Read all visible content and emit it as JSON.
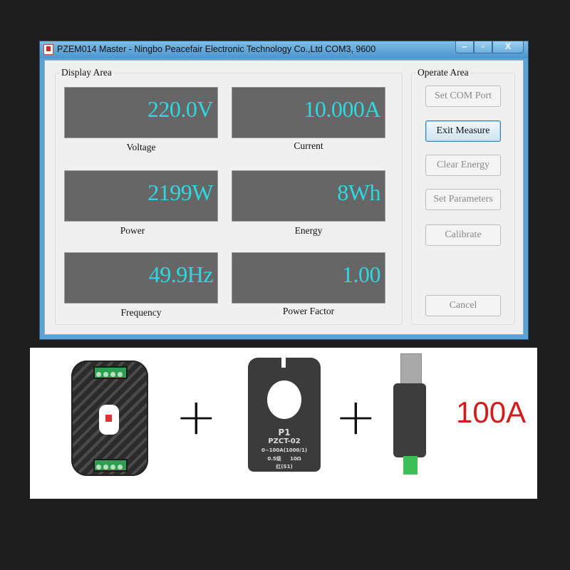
{
  "window": {
    "title": "PZEM014 Master - Ningbo Peacefair Electronic Technology Co.,Ltd  COM3, 9600",
    "controls": {
      "minimize": "‒",
      "maximize": "▫",
      "close": "X"
    }
  },
  "display_area": {
    "label": "Display Area",
    "readings": [
      {
        "label": "Voltage",
        "value": "220.0V"
      },
      {
        "label": "Current",
        "value": "10.000A"
      },
      {
        "label": "Power",
        "value": "2199W"
      },
      {
        "label": "Energy",
        "value": "8Wh"
      },
      {
        "label": "Frequency",
        "value": "49.9Hz"
      },
      {
        "label": "Power Factor",
        "value": "1.00"
      }
    ],
    "value_color": "#2fd8e0"
  },
  "operate_area": {
    "label": "Operate Area",
    "buttons": [
      {
        "label": "Set COM Port",
        "enabled": false
      },
      {
        "label": "Exit Measure",
        "enabled": true
      },
      {
        "label": "Clear Energy",
        "enabled": false
      },
      {
        "label": "Set Parameters",
        "enabled": false
      },
      {
        "label": "Calibrate",
        "enabled": false
      },
      {
        "label": "Cancel",
        "enabled": false
      }
    ]
  },
  "products": {
    "plus_1": "+",
    "plus_2": "+",
    "rating": "100A",
    "rating_color": "#d41a1a",
    "ct_lines": [
      "P1",
      "PZCT-02",
      "0~100A(1000/1)",
      "0.5级     10Ω",
      "红(S1)"
    ]
  }
}
